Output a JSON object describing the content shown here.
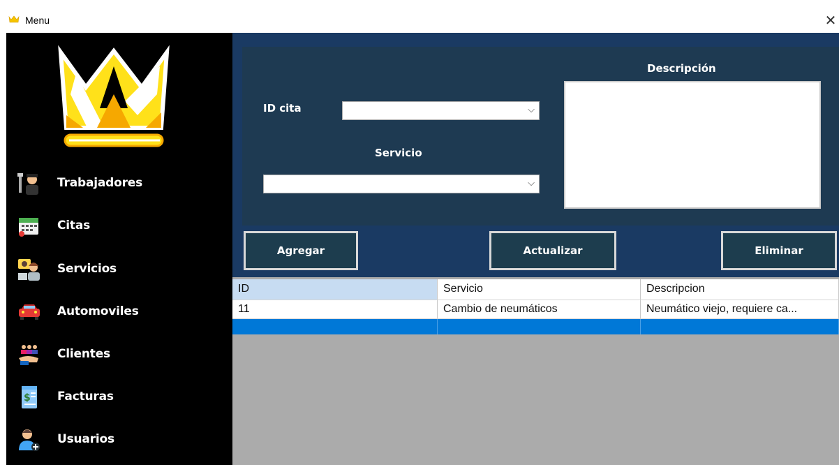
{
  "window": {
    "title": "Menu",
    "close_glyph": "✕"
  },
  "sidebar": {
    "logo": "crown-logo",
    "items": [
      {
        "label": "Trabajadores",
        "icon": "worker-icon"
      },
      {
        "label": "Citas",
        "icon": "calendar-icon"
      },
      {
        "label": "Servicios",
        "icon": "support-agent-icon"
      },
      {
        "label": "Automoviles",
        "icon": "car-icon"
      },
      {
        "label": "Clientes",
        "icon": "clients-icon"
      },
      {
        "label": "Facturas",
        "icon": "invoice-icon"
      },
      {
        "label": "Usuarios",
        "icon": "user-add-icon"
      }
    ]
  },
  "form": {
    "id_cita_label": "ID cita",
    "id_cita_value": "",
    "servicio_label": "Servicio",
    "servicio_value": "",
    "descripcion_label": "Descripción",
    "descripcion_value": "",
    "chevron": "⌵"
  },
  "buttons": {
    "agregar": "Agregar",
    "actualizar": "Actualizar",
    "eliminar": "Eliminar"
  },
  "table": {
    "columns": [
      "ID",
      "Servicio",
      "Descripcion"
    ],
    "rows": [
      [
        "11",
        "Cambio de neumáticos",
        "Neumático viejo, requiere ca..."
      ],
      [
        "",
        "",
        ""
      ]
    ]
  },
  "colors": {
    "sidebar_bg": "#000000",
    "panel_bg": "#1a3a63",
    "form_bg": "#1e3a52",
    "button_bg": "#1d3d4e",
    "selection": "#0078d7",
    "grid_bg": "#ababab"
  }
}
